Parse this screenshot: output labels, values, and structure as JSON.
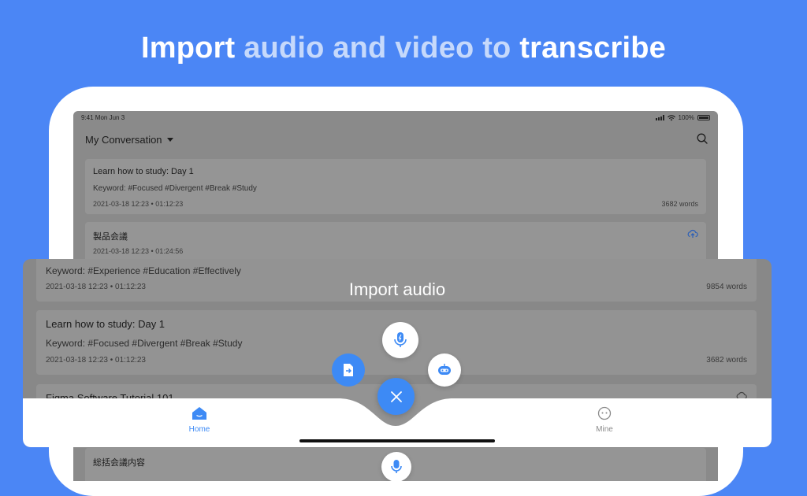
{
  "headline": {
    "word1": "Import",
    "word2": "audio and ",
    "word3": "video to",
    "word4": "transcribe"
  },
  "status_bar": {
    "time": "9:41  Mon Jun 3",
    "battery": "100%"
  },
  "header": {
    "title": "My Conversation"
  },
  "background_cards": [
    {
      "title": "Learn how to study: Day 1",
      "keywords": "Keyword:  #Focused  #Divergent  #Break  #Study",
      "date": "2021-03-18 12:23  •  01:12:23",
      "words": "3682 words"
    },
    {
      "title": "製品会議",
      "date": "2021-03-18 12:23  •  01:24:56"
    },
    {
      "title": "総括会議内容"
    }
  ],
  "overlay": {
    "title": "Import audio"
  },
  "panel_cards": [
    {
      "keywords": "Keyword:  #Experience  #Education  #Effectively",
      "date": "2021-03-18 12:23  •  01:12:23",
      "words": "9854 words"
    },
    {
      "title": "Learn how to study: Day 1",
      "keywords": "Keyword:  #Focused  #Divergent  #Break  #Study",
      "date": "2021-03-18 12:23  •  01:12:23",
      "words": "3682 words"
    },
    {
      "title": "Figma Software Tutorial 101"
    }
  ],
  "tabbar": {
    "home_label": "Home",
    "mine_label": "Mine"
  },
  "colors": {
    "background": "#4b86f5",
    "accent": "#3d8af5",
    "headline_muted": "#c6d9fb"
  },
  "icons": {
    "search": "search-icon",
    "upload": "cloud-upload-icon",
    "record": "microphone-icon",
    "import_file": "file-import-icon",
    "bot": "robot-icon",
    "close": "close-icon",
    "home": "home-icon",
    "mine": "profile-icon"
  }
}
